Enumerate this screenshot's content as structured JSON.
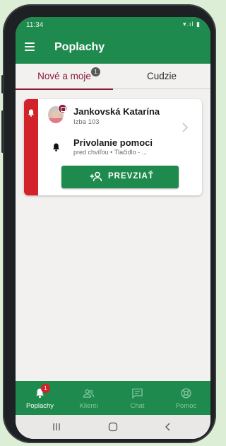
{
  "status_bar": {
    "time": "11:34",
    "icons": "▾.ıl ▮"
  },
  "app_bar": {
    "title": "Poplachy"
  },
  "tabs": [
    {
      "label": "Nové a moje",
      "badge": "1",
      "active": true
    },
    {
      "label": "Cudzie",
      "active": false
    }
  ],
  "alarm_card": {
    "client_name": "Jankovská Katarína",
    "room": "Izba 103",
    "alarm_title": "Privolanie pomoci",
    "meta": "pred chvíľou  •  Tlačidlo - ...",
    "action_label": "PREVZIAŤ",
    "stripe_color": "#d3222a"
  },
  "bottom_nav": [
    {
      "label": "Poplachy",
      "icon": "bell-icon",
      "badge": "1",
      "active": true
    },
    {
      "label": "Klienti",
      "icon": "people-icon",
      "active": false
    },
    {
      "label": "Chat",
      "icon": "chat-icon",
      "active": false
    },
    {
      "label": "Pomoc",
      "icon": "lifebuoy-icon",
      "active": false
    }
  ],
  "colors": {
    "primary": "#1f8a4d",
    "accent": "#8a1c3a",
    "alert": "#d3222a"
  }
}
